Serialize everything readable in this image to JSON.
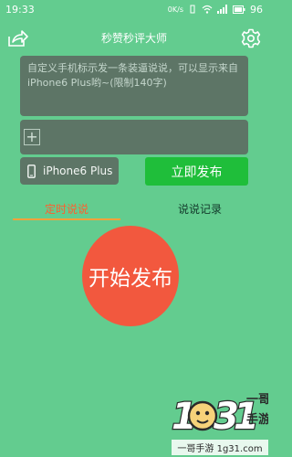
{
  "status_bar": {
    "time": "19:33",
    "data_speed": "0K/s",
    "battery": "96"
  },
  "header": {
    "title": "秒赞秒评大师"
  },
  "composer": {
    "placeholder": "自定义手机标示发一条装逼说说，可以显示来自iPhone6 Plus哟~(限制140字)",
    "add_image_label": "+"
  },
  "device": {
    "name": "iPhone6 Plus"
  },
  "actions": {
    "publish_now": "立即发布",
    "start_publish": "开始发布"
  },
  "tabs": [
    {
      "label": "定时说说",
      "active": true
    },
    {
      "label": "说说记录",
      "active": false
    }
  ],
  "watermark": {
    "digits": "1g31",
    "brand": "一哥手游",
    "url": "一哥手游 1g31.com"
  },
  "colors": {
    "background": "#63cc8f",
    "panel": "#5d7566",
    "publish_button": "#1fbe3a",
    "start_button": "#f2583e",
    "active_tab": "#ff5e2e",
    "tab_underline": "#f7a23b"
  },
  "icons": {
    "share": "share-icon",
    "settings": "gear-icon",
    "device": "phone-icon",
    "add": "plus-icon"
  }
}
